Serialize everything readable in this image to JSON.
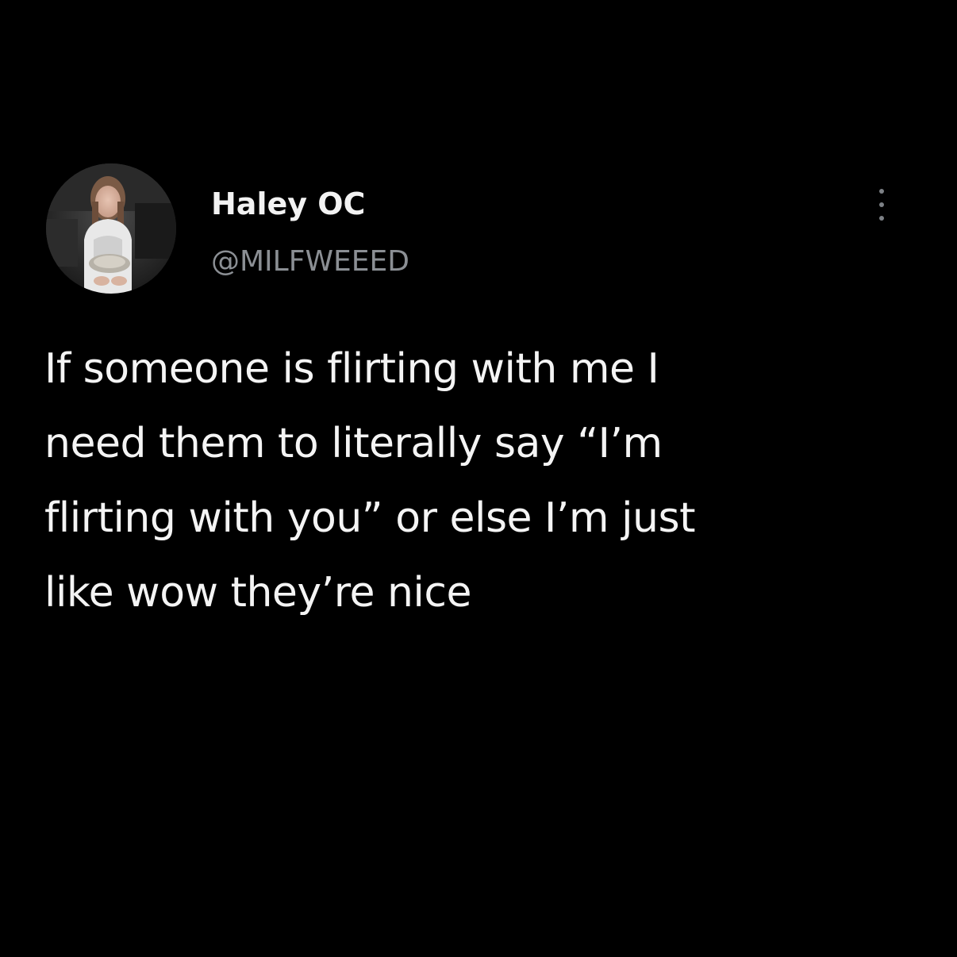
{
  "tweet": {
    "author": {
      "display_name": "Haley OC",
      "handle": "@MILFWEEED"
    },
    "more_icon": "more-vertical-icon",
    "text_lines": [
      "If someone is flirting with me I",
      "need them to literally say “I’m",
      "flirting with you” or else I’m just",
      "like wow they’re nice"
    ]
  },
  "colors": {
    "background": "#000000",
    "text": "#f4f4f4",
    "handle": "#8b8f94"
  }
}
